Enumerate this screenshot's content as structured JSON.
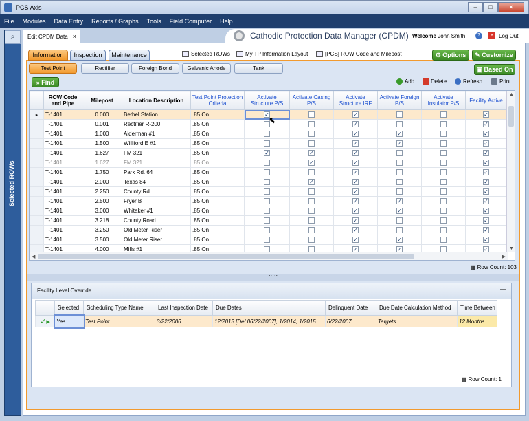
{
  "app": {
    "title": "PCS Axis",
    "brand_title": "Cathodic Protection Data Manager (CPDM)",
    "welcome_prefix": "Welcome",
    "user": "John Smith",
    "logout": "Log Out",
    "minimize": "–",
    "maximize": "□",
    "close": "×"
  },
  "menu": [
    "File",
    "Modules",
    "Data Entry",
    "Reports / Graphs",
    "Tools",
    "Field Computer",
    "Help"
  ],
  "sidebar": {
    "label": "Selected ROWs"
  },
  "doc_tab": {
    "label": "Edit CPDM Data",
    "close": "×"
  },
  "tabs": [
    "Information",
    "Inspection",
    "Maintenance"
  ],
  "tab_links": [
    "Selected ROWs",
    "My TP Information Layout",
    "[PCS] ROW Code and Milepost"
  ],
  "options": "Options",
  "customize": "Customize",
  "based_on": "Based On",
  "subtabs": [
    "Test Point",
    "Rectifier",
    "Foreign Bond",
    "Galvanic Anode",
    "Tank"
  ],
  "toolbar": {
    "find": "Find",
    "add": "Add",
    "delete": "Delete",
    "refresh": "Refresh",
    "print": "Print"
  },
  "grid": {
    "columns": [
      "ROW Code and Pipe",
      "Milepost",
      "Location Description",
      "Test Point Protection Criteria",
      "Activate Structure P/S",
      "Activate Casing P/S",
      "Activate Structure IRF",
      "Activate Foreign P/S",
      "Activate Insulator P/S",
      "Facility Active"
    ],
    "rows": [
      {
        "row": "T-1401",
        "mp": "0.000",
        "loc": "Bethel Station",
        "crit": ".85 On",
        "c": [
          1,
          0,
          1,
          0,
          0,
          1
        ],
        "sel": true
      },
      {
        "row": "T-1401",
        "mp": "0.001",
        "loc": "Rectifier R-200",
        "crit": ".85 On",
        "c": [
          0,
          0,
          1,
          0,
          0,
          1
        ]
      },
      {
        "row": "T-1401",
        "mp": "1.000",
        "loc": "Alderman #1",
        "crit": ".85 On",
        "c": [
          0,
          0,
          1,
          1,
          0,
          1
        ]
      },
      {
        "row": "T-1401",
        "mp": "1.500",
        "loc": "Williford E #1",
        "crit": ".85 On",
        "c": [
          0,
          0,
          1,
          1,
          0,
          1
        ]
      },
      {
        "row": "T-1401",
        "mp": "1.627",
        "loc": "FM 321",
        "crit": ".85 On",
        "c": [
          1,
          1,
          1,
          0,
          0,
          1
        ]
      },
      {
        "row": "T-1401",
        "mp": "1.627",
        "loc": "FM 321",
        "crit": ".85 On",
        "c": [
          0,
          1,
          1,
          0,
          0,
          1
        ],
        "dim": true
      },
      {
        "row": "T-1401",
        "mp": "1.750",
        "loc": "Park Rd. 64",
        "crit": ".85 On",
        "c": [
          0,
          0,
          1,
          0,
          0,
          1
        ]
      },
      {
        "row": "T-1401",
        "mp": "2.000",
        "loc": "Texas 84",
        "crit": ".85 On",
        "c": [
          0,
          1,
          1,
          0,
          0,
          1
        ]
      },
      {
        "row": "T-1401",
        "mp": "2.250",
        "loc": "County Rd.",
        "crit": ".85 On",
        "c": [
          0,
          0,
          1,
          0,
          0,
          1
        ]
      },
      {
        "row": "T-1401",
        "mp": "2.500",
        "loc": "Fryer B",
        "crit": ".85 On",
        "c": [
          0,
          0,
          1,
          1,
          0,
          1
        ]
      },
      {
        "row": "T-1401",
        "mp": "3.000",
        "loc": "Whitaker #1",
        "crit": ".85 On",
        "c": [
          0,
          0,
          1,
          1,
          0,
          1
        ]
      },
      {
        "row": "T-1401",
        "mp": "3.218",
        "loc": "County Road",
        "crit": ".85 On",
        "c": [
          0,
          0,
          1,
          0,
          0,
          1
        ]
      },
      {
        "row": "T-1401",
        "mp": "3.250",
        "loc": "Old Meter Riser",
        "crit": ".85 On",
        "c": [
          0,
          0,
          1,
          0,
          0,
          1
        ]
      },
      {
        "row": "T-1401",
        "mp": "3.500",
        "loc": "Old Meter Riser",
        "crit": ".85 On",
        "c": [
          0,
          0,
          1,
          1,
          0,
          1
        ]
      },
      {
        "row": "T-1401",
        "mp": "4.000",
        "loc": "Mills #1",
        "crit": ".85 On",
        "c": [
          0,
          0,
          1,
          1,
          0,
          1
        ]
      }
    ],
    "row_count": "Row Count: 103"
  },
  "override": {
    "title": "Facility Level Override",
    "min": "—",
    "columns": [
      "Selected",
      "Scheduling Type Name",
      "Last Inspection Date",
      "Due Dates",
      "Delinquent Date",
      "Due Date Calculation Method",
      "Time Between"
    ],
    "row": [
      "Yes",
      "Test Point",
      "3/22/2006",
      "12/2013 [Del 06/22/2007], 1/2014, 1/2015",
      "6/22/2007",
      "Targets",
      "12 Months"
    ],
    "row_count": "Row Count: 1"
  }
}
